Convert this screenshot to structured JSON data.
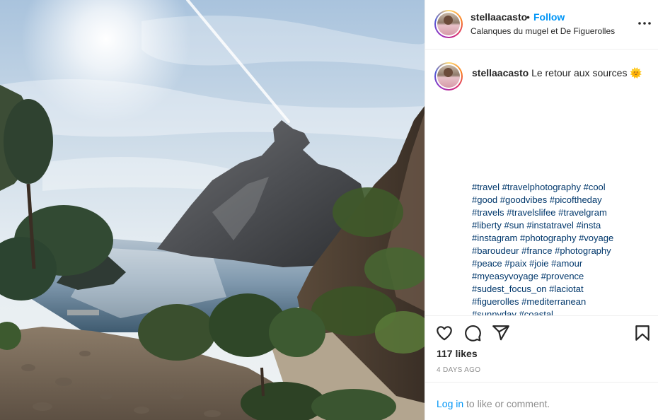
{
  "post": {
    "username": "stellaacasto",
    "dot": "•",
    "follow_label": "Follow",
    "location": "Calanques du mugel et De Figuerolles",
    "more_icon": "more-horizontal-icon",
    "more_label": "•••"
  },
  "caption": {
    "username": "stellaacasto",
    "text": "Le retour aux sources 🌞",
    "hashtag_lines": [
      "#travel #travelphotography #cool",
      "#good #goodvibes #picoftheday",
      "#travels #travelslifee #travelgram",
      "#liberty #sun #instatravel #insta",
      "#instagram #photography #voyage",
      "#baroudeur #france #photography",
      "#peace #paix #joie #amour",
      "#myeasyvoyage #provence",
      "#sudest_focus_on #laciotat",
      "#figuerolles #mediterranean",
      "#sunnyday #coastal"
    ]
  },
  "actions": {
    "like_icon": "heart-icon",
    "comment_icon": "comment-icon",
    "share_icon": "paper-plane-icon",
    "save_icon": "bookmark-icon"
  },
  "stats": {
    "likes": "117 likes",
    "date": "4 DAYS AGO"
  },
  "comment_bar": {
    "login_label": "Log in",
    "rest_text": " to like or comment."
  },
  "colors": {
    "link_blue": "#0095f6",
    "hashtag_blue": "#00376b",
    "muted": "#8e8e8e",
    "text": "#262626",
    "divider": "#efefef"
  }
}
